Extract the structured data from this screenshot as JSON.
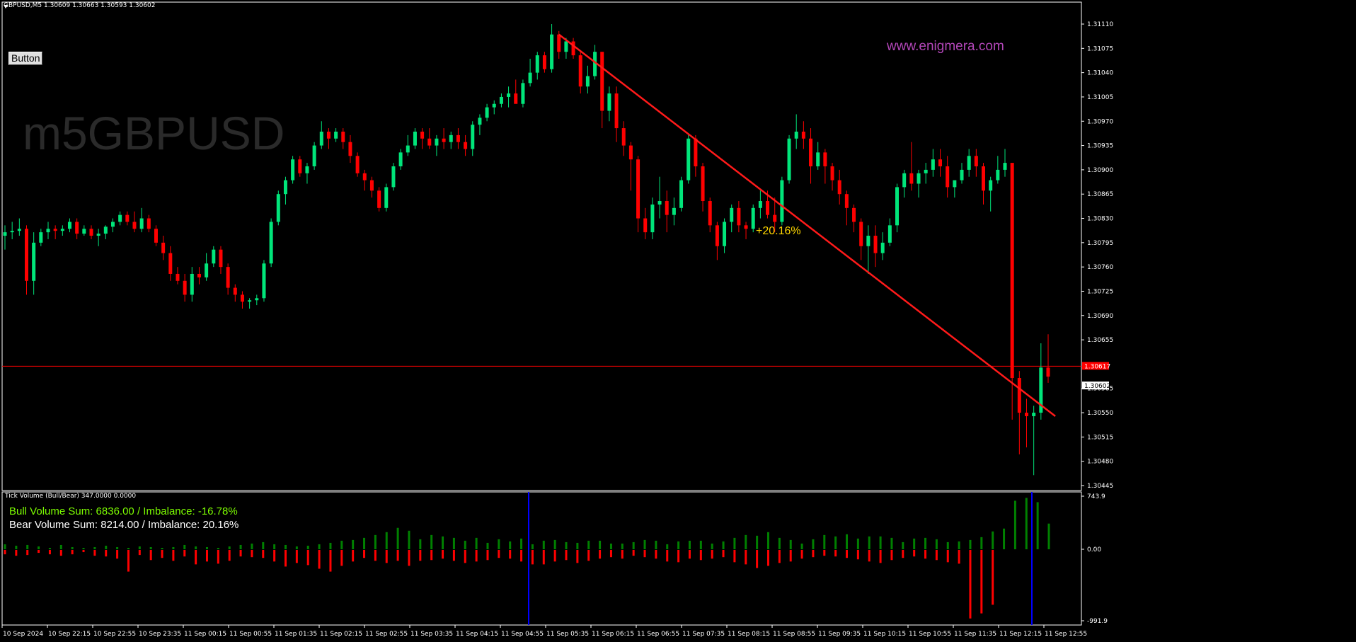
{
  "header": {
    "main": "GBPUSD,M5  1.30609 1.30663 1.30593 1.30602",
    "sub": "Tick Volume (Bull/Bear) 347.0000 0.0000"
  },
  "button_label": "Button",
  "watermark": "m5GBPUSD",
  "site": "www.enigmera.com",
  "annotation": "+20.16%",
  "info": {
    "bull": "Bull Volume Sum: 6836.00 / Imbalance: -16.78%",
    "bear": "Bear Volume Sum: 8214.00 / Imbalance: 20.16%"
  },
  "colors": {
    "bull": "#00e57a",
    "bear": "#ff0000",
    "trend": "#ff1a1a",
    "vol_bull": "#008000",
    "vol_bear": "#ff0000",
    "marker": "#0000ff",
    "grid_line": "#ff0000"
  },
  "chart_data": [
    {
      "type": "candlestick",
      "symbol": "GBPUSD",
      "timeframe": "M5",
      "ylim": [
        1.30445,
        1.3111
      ],
      "y_ticks": [
        "1.31110",
        "1.31075",
        "1.31040",
        "1.31005",
        "1.30970",
        "1.30935",
        "1.30900",
        "1.30865",
        "1.30830",
        "1.30795",
        "1.30760",
        "1.30725",
        "1.30690",
        "1.30655",
        "1.30585",
        "1.30550",
        "1.30515",
        "1.30480",
        "1.30445"
      ],
      "price_labels": [
        "1.30617",
        "1.30602"
      ],
      "current_line": 1.30617,
      "x_ticks": [
        "10 Sep 2024",
        "10 Sep 22:15",
        "10 Sep 22:55",
        "10 Sep 23:35",
        "11 Sep 00:15",
        "11 Sep 00:55",
        "11 Sep 01:35",
        "11 Sep 02:15",
        "11 Sep 02:55",
        "11 Sep 03:35",
        "11 Sep 04:15",
        "11 Sep 04:55",
        "11 Sep 05:35",
        "11 Sep 06:15",
        "11 Sep 06:55",
        "11 Sep 07:35",
        "11 Sep 08:15",
        "11 Sep 08:55",
        "11 Sep 09:35",
        "11 Sep 10:15",
        "11 Sep 10:55",
        "11 Sep 11:35",
        "11 Sep 12:15",
        "11 Sep 12:55"
      ],
      "trendline": {
        "from": {
          "time": "11 Sep 04:55",
          "price": 1.31095
        },
        "to": {
          "time": "11 Sep 12:30",
          "price": 1.30545
        },
        "label": "+20.16%"
      },
      "ohlc": [
        [
          1.30805,
          1.3082,
          1.30785,
          1.3081
        ],
        [
          1.3081,
          1.30825,
          1.308,
          1.30812
        ],
        [
          1.30812,
          1.3083,
          1.30805,
          1.30815
        ],
        [
          1.30815,
          1.3082,
          1.3072,
          1.3074
        ],
        [
          1.3074,
          1.3081,
          1.3072,
          1.30795
        ],
        [
          1.30795,
          1.30815,
          1.3079,
          1.3081
        ],
        [
          1.3081,
          1.30825,
          1.308,
          1.30815
        ],
        [
          1.30815,
          1.3082,
          1.308,
          1.30812
        ],
        [
          1.30812,
          1.3082,
          1.30805,
          1.30815
        ],
        [
          1.30815,
          1.3083,
          1.3081,
          1.30825
        ],
        [
          1.30825,
          1.3083,
          1.308,
          1.30808
        ],
        [
          1.30808,
          1.3082,
          1.30805,
          1.30815
        ],
        [
          1.30815,
          1.3082,
          1.308,
          1.30805
        ],
        [
          1.30805,
          1.30815,
          1.3079,
          1.30808
        ],
        [
          1.30808,
          1.3082,
          1.308,
          1.30818
        ],
        [
          1.30818,
          1.3083,
          1.3081,
          1.30825
        ],
        [
          1.30825,
          1.3084,
          1.3082,
          1.30835
        ],
        [
          1.30835,
          1.3084,
          1.3082,
          1.30825
        ],
        [
          1.30825,
          1.3084,
          1.3081,
          1.30815
        ],
        [
          1.30815,
          1.30845,
          1.3081,
          1.3083
        ],
        [
          1.3083,
          1.30835,
          1.3081,
          1.30815
        ],
        [
          1.30815,
          1.3082,
          1.3079,
          1.30795
        ],
        [
          1.30795,
          1.30805,
          1.3077,
          1.3078
        ],
        [
          1.3078,
          1.3079,
          1.3074,
          1.3075
        ],
        [
          1.3075,
          1.3076,
          1.30735,
          1.3074
        ],
        [
          1.3074,
          1.3075,
          1.3071,
          1.3072
        ],
        [
          1.3072,
          1.3076,
          1.3071,
          1.3075
        ],
        [
          1.3075,
          1.3076,
          1.30735,
          1.30745
        ],
        [
          1.30745,
          1.3078,
          1.3074,
          1.30765
        ],
        [
          1.30765,
          1.3079,
          1.3076,
          1.30785
        ],
        [
          1.30785,
          1.3079,
          1.3075,
          1.3076
        ],
        [
          1.3076,
          1.30765,
          1.3072,
          1.3073
        ],
        [
          1.3073,
          1.30735,
          1.3071,
          1.3072
        ],
        [
          1.3072,
          1.30725,
          1.307,
          1.3071
        ],
        [
          1.3071,
          1.30715,
          1.307,
          1.30712
        ],
        [
          1.30712,
          1.3072,
          1.30705,
          1.30715
        ],
        [
          1.30715,
          1.3077,
          1.3071,
          1.30765
        ],
        [
          1.30765,
          1.3083,
          1.3076,
          1.30825
        ],
        [
          1.30825,
          1.3087,
          1.3082,
          1.30865
        ],
        [
          1.30865,
          1.3089,
          1.3085,
          1.30885
        ],
        [
          1.30885,
          1.3092,
          1.3088,
          1.30915
        ],
        [
          1.30915,
          1.3092,
          1.3089,
          1.30895
        ],
        [
          1.30895,
          1.3091,
          1.3088,
          1.30905
        ],
        [
          1.30905,
          1.3094,
          1.309,
          1.30935
        ],
        [
          1.30935,
          1.3097,
          1.3093,
          1.30955
        ],
        [
          1.30955,
          1.3096,
          1.3093,
          1.30945
        ],
        [
          1.30945,
          1.3096,
          1.3094,
          1.30955
        ],
        [
          1.30955,
          1.3096,
          1.3093,
          1.3094
        ],
        [
          1.3094,
          1.3095,
          1.3091,
          1.3092
        ],
        [
          1.3092,
          1.30925,
          1.3089,
          1.30895
        ],
        [
          1.30895,
          1.309,
          1.3087,
          1.30885
        ],
        [
          1.30885,
          1.3089,
          1.3086,
          1.3087
        ],
        [
          1.3087,
          1.30875,
          1.3084,
          1.30845
        ],
        [
          1.30845,
          1.3088,
          1.3084,
          1.30875
        ],
        [
          1.30875,
          1.3091,
          1.3087,
          1.30905
        ],
        [
          1.30905,
          1.3093,
          1.309,
          1.30925
        ],
        [
          1.30925,
          1.3095,
          1.3092,
          1.30935
        ],
        [
          1.30935,
          1.3096,
          1.3093,
          1.30955
        ],
        [
          1.30955,
          1.3096,
          1.3093,
          1.30945
        ],
        [
          1.30945,
          1.3096,
          1.3093,
          1.30935
        ],
        [
          1.30935,
          1.3095,
          1.3092,
          1.30945
        ],
        [
          1.30945,
          1.3096,
          1.3093,
          1.3094
        ],
        [
          1.3094,
          1.30955,
          1.3093,
          1.3095
        ],
        [
          1.3095,
          1.3096,
          1.3093,
          1.3094
        ],
        [
          1.3094,
          1.3095,
          1.3092,
          1.3093
        ],
        [
          1.3093,
          1.3097,
          1.3092,
          1.30965
        ],
        [
          1.30965,
          1.3098,
          1.3095,
          1.30975
        ],
        [
          1.30975,
          1.30995,
          1.3097,
          1.3099
        ],
        [
          1.3099,
          1.31,
          1.3098,
          1.30995
        ],
        [
          1.30995,
          1.3101,
          1.3099,
          1.31005
        ],
        [
          1.31005,
          1.3102,
          1.3099,
          1.3101
        ],
        [
          1.3101,
          1.3103,
          1.31,
          1.30995
        ],
        [
          1.30995,
          1.3103,
          1.3099,
          1.31025
        ],
        [
          1.31025,
          1.3106,
          1.3102,
          1.3104
        ],
        [
          1.3104,
          1.3107,
          1.3103,
          1.31065
        ],
        [
          1.31065,
          1.3107,
          1.3104,
          1.31045
        ],
        [
          1.31045,
          1.3111,
          1.3104,
          1.31095
        ],
        [
          1.31095,
          1.311,
          1.3106,
          1.3107
        ],
        [
          1.3107,
          1.3109,
          1.3106,
          1.31085
        ],
        [
          1.31085,
          1.3109,
          1.3106,
          1.31065
        ],
        [
          1.31065,
          1.3107,
          1.3101,
          1.3102
        ],
        [
          1.3102,
          1.3105,
          1.3101,
          1.31035
        ],
        [
          1.31035,
          1.3108,
          1.3103,
          1.3107
        ],
        [
          1.3107,
          1.3107,
          1.3096,
          1.30985
        ],
        [
          1.30985,
          1.3102,
          1.3097,
          1.3101
        ],
        [
          1.3101,
          1.3102,
          1.3094,
          1.3096
        ],
        [
          1.3096,
          1.3097,
          1.3092,
          1.30935
        ],
        [
          1.30935,
          1.3094,
          1.3087,
          1.30915
        ],
        [
          1.30915,
          1.3092,
          1.3081,
          1.3083
        ],
        [
          1.3083,
          1.30845,
          1.308,
          1.3081
        ],
        [
          1.3081,
          1.3086,
          1.308,
          1.3085
        ],
        [
          1.3085,
          1.3089,
          1.3083,
          1.30855
        ],
        [
          1.30855,
          1.3087,
          1.3081,
          1.30835
        ],
        [
          1.30835,
          1.3086,
          1.3082,
          1.30845
        ],
        [
          1.30845,
          1.3089,
          1.3084,
          1.30885
        ],
        [
          1.30885,
          1.3095,
          1.3088,
          1.30945
        ],
        [
          1.30945,
          1.3095,
          1.3089,
          1.30905
        ],
        [
          1.30905,
          1.3091,
          1.3084,
          1.30855
        ],
        [
          1.30855,
          1.3086,
          1.3081,
          1.3082
        ],
        [
          1.3082,
          1.30825,
          1.3077,
          1.3079
        ],
        [
          1.3079,
          1.3083,
          1.3078,
          1.30825
        ],
        [
          1.30825,
          1.3085,
          1.3081,
          1.30845
        ],
        [
          1.30845,
          1.30855,
          1.3081,
          1.3082
        ],
        [
          1.3082,
          1.30825,
          1.308,
          1.30815
        ],
        [
          1.30815,
          1.3085,
          1.3081,
          1.30845
        ],
        [
          1.30845,
          1.3087,
          1.3083,
          1.30855
        ],
        [
          1.30855,
          1.3087,
          1.3083,
          1.30835
        ],
        [
          1.30835,
          1.3086,
          1.3081,
          1.30825
        ],
        [
          1.30825,
          1.3089,
          1.3082,
          1.30885
        ],
        [
          1.30885,
          1.3095,
          1.3088,
          1.30945
        ],
        [
          1.30945,
          1.3098,
          1.3093,
          1.30955
        ],
        [
          1.30955,
          1.3097,
          1.3093,
          1.30945
        ],
        [
          1.30945,
          1.3096,
          1.3088,
          1.30905
        ],
        [
          1.30905,
          1.3094,
          1.309,
          1.30925
        ],
        [
          1.30925,
          1.3093,
          1.3088,
          1.30905
        ],
        [
          1.30905,
          1.3091,
          1.3087,
          1.30885
        ],
        [
          1.30885,
          1.309,
          1.3085,
          1.30865
        ],
        [
          1.30865,
          1.3087,
          1.3082,
          1.30845
        ],
        [
          1.30845,
          1.3085,
          1.3081,
          1.30825
        ],
        [
          1.30825,
          1.3083,
          1.3077,
          1.3079
        ],
        [
          1.3079,
          1.3082,
          1.3075,
          1.30805
        ],
        [
          1.30805,
          1.3082,
          1.3076,
          1.3078
        ],
        [
          1.3078,
          1.3081,
          1.3077,
          1.30795
        ],
        [
          1.30795,
          1.3083,
          1.3079,
          1.3082
        ],
        [
          1.3082,
          1.3088,
          1.3081,
          1.30875
        ],
        [
          1.30875,
          1.309,
          1.3086,
          1.30895
        ],
        [
          1.30895,
          1.3094,
          1.3087,
          1.3088
        ],
        [
          1.3088,
          1.309,
          1.3086,
          1.30895
        ],
        [
          1.30895,
          1.3091,
          1.3088,
          1.309
        ],
        [
          1.309,
          1.3093,
          1.3089,
          1.30915
        ],
        [
          1.30915,
          1.3093,
          1.3089,
          1.30905
        ],
        [
          1.30905,
          1.3092,
          1.3086,
          1.30875
        ],
        [
          1.30875,
          1.3088,
          1.3086,
          1.30885
        ],
        [
          1.30885,
          1.3091,
          1.3088,
          1.309
        ],
        [
          1.309,
          1.3093,
          1.3089,
          1.3092
        ],
        [
          1.3092,
          1.3093,
          1.3089,
          1.30905
        ],
        [
          1.30905,
          1.3091,
          1.3085,
          1.3087
        ],
        [
          1.3087,
          1.3089,
          1.3084,
          1.30885
        ],
        [
          1.30885,
          1.3092,
          1.3088,
          1.309
        ],
        [
          1.309,
          1.3093,
          1.3089,
          1.3091
        ],
        [
          1.3091,
          1.309,
          1.3054,
          1.306
        ],
        [
          1.306,
          1.3061,
          1.3049,
          1.3055
        ],
        [
          1.3055,
          1.3057,
          1.305,
          1.30545
        ],
        [
          1.30545,
          1.3056,
          1.3046,
          1.3055
        ],
        [
          1.3055,
          1.3065,
          1.3054,
          1.30615
        ],
        [
          1.30615,
          1.30663,
          1.30593,
          1.30602
        ]
      ]
    },
    {
      "type": "bar",
      "title": "Tick Volume (Bull/Bear) 347.0000 0.0000",
      "ylim": [
        -991.9,
        743.9
      ],
      "y_ticks": [
        "743.9",
        "0.00",
        "-991.9"
      ],
      "bull_sum": 6836.0,
      "bear_sum": 8214.0,
      "bull_imbalance": "-16.78%",
      "bear_imbalance": "20.16%",
      "marker_times": [
        "11 Sep 04:55",
        "11 Sep 12:35"
      ],
      "bull": [
        70,
        50,
        60,
        40,
        20,
        60,
        30,
        20,
        30,
        50,
        30,
        20,
        40,
        30,
        20,
        30,
        60,
        40,
        30,
        20,
        40,
        60,
        80,
        100,
        70,
        60,
        40,
        50,
        70,
        90,
        120,
        130,
        160,
        200,
        240,
        300,
        260,
        140,
        200,
        180,
        160,
        120,
        160,
        90,
        140,
        110,
        150,
        70,
        120,
        130,
        100,
        90,
        120,
        120,
        80,
        80,
        100,
        130,
        120,
        70,
        110,
        120,
        120,
        80,
        110,
        160,
        200,
        190,
        240,
        160,
        130,
        80,
        140,
        200,
        180,
        210,
        150,
        180,
        180,
        160,
        100,
        150,
        160,
        140,
        100,
        110,
        130,
        170,
        250,
        290,
        680,
        720,
        660,
        360
      ],
      "bear": [
        -60,
        -80,
        -70,
        -40,
        -60,
        -80,
        -60,
        -30,
        -80,
        -90,
        -120,
        -300,
        -70,
        -140,
        -110,
        -150,
        -90,
        -200,
        -160,
        -190,
        -150,
        -90,
        -100,
        -110,
        -160,
        -230,
        -180,
        -210,
        -260,
        -300,
        -220,
        -160,
        -110,
        -150,
        -180,
        -150,
        -220,
        -150,
        -140,
        -120,
        -150,
        -180,
        -160,
        -140,
        -110,
        -120,
        -160,
        -200,
        -200,
        -160,
        -140,
        -180,
        -150,
        -120,
        -100,
        -120,
        -80,
        -100,
        -120,
        -160,
        -170,
        -120,
        -140,
        -120,
        -100,
        -170,
        -200,
        -250,
        -220,
        -180,
        -160,
        -120,
        -100,
        -80,
        -90,
        -110,
        -130,
        -160,
        -180,
        -140,
        -110,
        -90,
        -120,
        -140,
        -170,
        -190,
        -950,
        -880,
        -760,
        0,
        0,
        0,
        0,
        0
      ]
    }
  ]
}
